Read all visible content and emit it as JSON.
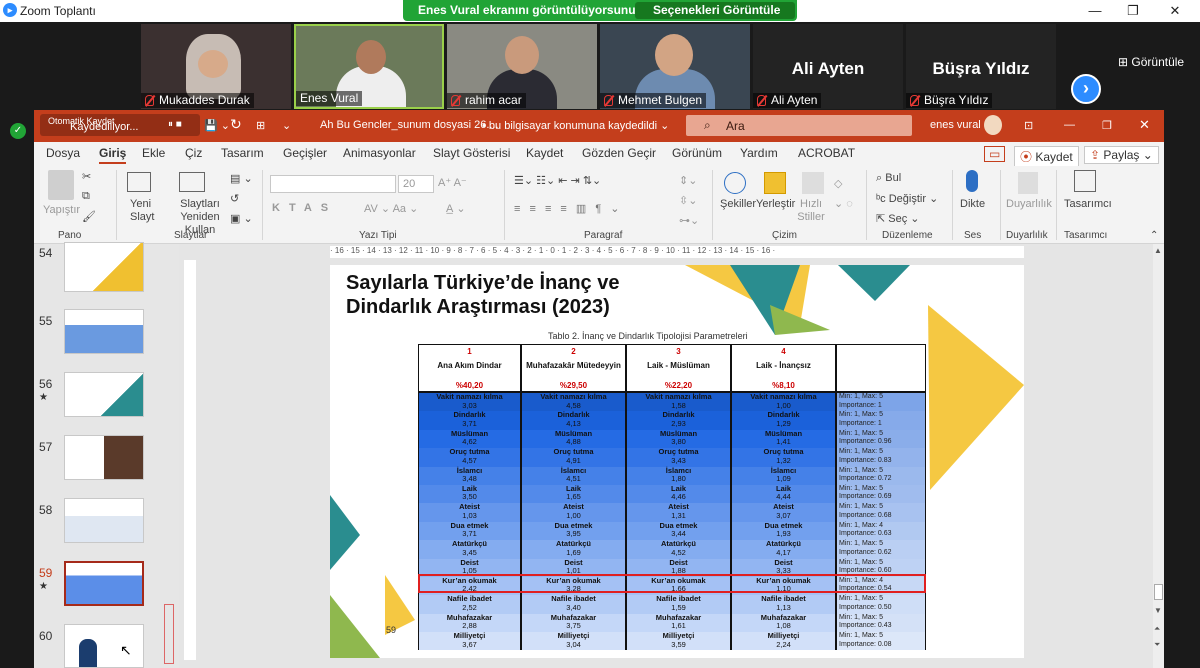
{
  "zoom": {
    "app_title": "Zoom Toplantı",
    "share_banner": "Enes Vural ekranını görüntülüyorsunuz",
    "view_options": "Seçenekleri Görüntüle",
    "gallery_view": "Görüntüle",
    "participants": [
      {
        "name": "Mukaddes Durak",
        "muted": true
      },
      {
        "name": "Enes Vural",
        "muted": false
      },
      {
        "name": "rahim acar",
        "muted": true
      },
      {
        "name": "Mehmet Bulgen",
        "muted": true
      },
      {
        "name": "Ali Ayten",
        "muted": true,
        "big": "Ali Ayten"
      },
      {
        "name": "Büşra Yıldız",
        "muted": true,
        "big": "Büşra Yıldız"
      }
    ],
    "colors": {
      "accent": "#2d8cff",
      "banner": "#21a436",
      "mute": "#e53935"
    }
  },
  "ppt": {
    "autosave": "Otomatik Kaydet",
    "saving": "Kaydediliyor...",
    "doc_title": "Ah Bu Gencler_sunum dosyasi 26....",
    "save_location": "bu bilgisayar konumuna kaydedildi",
    "search": "Ara",
    "user": "enes vural",
    "title_color": "#c43e1c",
    "tabs": [
      "Dosya",
      "Giriş",
      "Ekle",
      "Çiz",
      "Tasarım",
      "Geçişler",
      "Animasyonlar",
      "Slayt Gösterisi",
      "Kaydet",
      "Gözden Geçir",
      "Görünüm",
      "Yardım",
      "ACROBAT"
    ],
    "record_btn": "Kaydet",
    "share_btn": "Paylaş",
    "ribbon": {
      "paste": "Yapıştır",
      "new_slide": "Yeni Slayt",
      "reuse": "Slaytları Yeniden Kullan",
      "font_size": "20",
      "shapes": "Şekiller",
      "arrange": "Yerleştir",
      "quick_styles": "Hızlı Stiller",
      "find": "Bul",
      "replace": "Değiştir",
      "select": "Seç",
      "dictate": "Dikte",
      "sensitivity": "Duyarlılık",
      "designer": "Tasarımcı",
      "groups": [
        "Pano",
        "Slaytlar",
        "Yazı Tipi",
        "Paragraf",
        "Çizim",
        "Düzenleme",
        "Ses",
        "Duyarlılık",
        "Tasarımcı"
      ]
    },
    "slide_numbers": [
      "54",
      "55",
      "56",
      "57",
      "58",
      "59",
      "60"
    ],
    "current_slide": "59",
    "ruler": "· 16 · 15 · 14 · 13 · 12 · 11 · 10 · 9 · 8 · 7 · 6 · 5 · 4 · 3 · 2 · 1 · 0 · 1 · 2 · 3 · 4 · 5 · 6 · 7 · 8 · 9 · 10 · 11 · 12 · 13 · 14 · 15 · 16 ·",
    "slide": {
      "title": "Sayılarla Türkiye’de İnanç ve Dindarlık Araştırması (2023)",
      "caption": "Tablo 2. İnanç ve Dindarlık Tipolojisi Parametreleri",
      "page_number": "59",
      "columns": [
        {
          "num": "1",
          "name": "Ana Akım Dindar",
          "pct": "%40,20"
        },
        {
          "num": "2",
          "name": "Muhafazakâr Mütedeyyin",
          "pct": "%29,50"
        },
        {
          "num": "3",
          "name": "Laik - Müslüman",
          "pct": "%22,20"
        },
        {
          "num": "4",
          "name": "Laik - İnançsız",
          "pct": "%8,10"
        }
      ],
      "rows": [
        {
          "label": "Vakit namazı kılma",
          "vals": [
            "3,03",
            "4,58",
            "1,58",
            "1,00"
          ],
          "range": "Min: 1, Max: 5",
          "importance": "Importance: 1"
        },
        {
          "label": "Dindarlık",
          "vals": [
            "3,71",
            "4,13",
            "2,93",
            "1,29"
          ],
          "range": "Min: 1, Max: 5",
          "importance": "Importance: 1"
        },
        {
          "label": "Müslüman",
          "vals": [
            "4,62",
            "4,88",
            "3,80",
            "1,41"
          ],
          "range": "Min: 1, Max: 5",
          "importance": "Importance: 0.96"
        },
        {
          "label": "Oruç tutma",
          "vals": [
            "4,57",
            "4,91",
            "3,43",
            "1,32"
          ],
          "range": "Min: 1, Max: 5",
          "importance": "Importance: 0.83"
        },
        {
          "label": "İslamcı",
          "vals": [
            "3,48",
            "4,51",
            "1,80",
            "1,09"
          ],
          "range": "Min: 1, Max: 5",
          "importance": "Importance: 0.72"
        },
        {
          "label": "Laik",
          "vals": [
            "3,50",
            "1,65",
            "4,46",
            "4,44"
          ],
          "range": "Min: 1, Max: 5",
          "importance": "Importance: 0.69"
        },
        {
          "label": "Ateist",
          "vals": [
            "1,03",
            "1,00",
            "1,31",
            "3,07"
          ],
          "range": "Min: 1, Max: 5",
          "importance": "Importance: 0.68"
        },
        {
          "label": "Dua etmek",
          "vals": [
            "3,71",
            "3,95",
            "3,44",
            "1,93"
          ],
          "range": "Min: 1, Max: 4",
          "importance": "Importance: 0.63"
        },
        {
          "label": "Atatürkçü",
          "vals": [
            "3,45",
            "1,69",
            "4,52",
            "4,17"
          ],
          "range": "Min: 1, Max: 5",
          "importance": "Importance: 0.62"
        },
        {
          "label": "Deist",
          "vals": [
            "1,05",
            "1,01",
            "1,88",
            "3,33"
          ],
          "range": "Min: 1, Max: 5",
          "importance": "Importance: 0.60"
        },
        {
          "label": "Kur’an okumak",
          "vals": [
            "2,42",
            "3,28",
            "1,66",
            "1,10"
          ],
          "range": "Min: 1, Max: 4",
          "importance": "Importance: 0.54"
        },
        {
          "label": "Nafile ibadet",
          "vals": [
            "2,52",
            "3,40",
            "1,59",
            "1,13"
          ],
          "range": "Min: 1, Max: 5",
          "importance": "Importance: 0.50"
        },
        {
          "label": "Muhafazakar",
          "vals": [
            "2,88",
            "3,75",
            "1,61",
            "1,08"
          ],
          "range": "Min: 1, Max: 5",
          "importance": "Importance: 0.43"
        },
        {
          "label": "Milliyetçi",
          "vals": [
            "3,67",
            "3,04",
            "3,59",
            "2,24"
          ],
          "range": "Min: 1, Max: 5",
          "importance": "Importance: 0.08"
        }
      ],
      "highlighted_row": "Kur’an okumak"
    }
  }
}
